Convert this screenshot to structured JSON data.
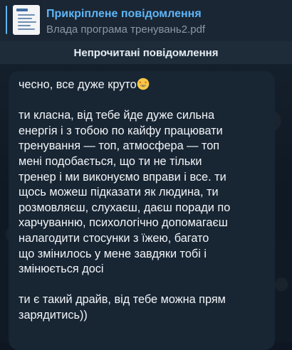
{
  "pinned": {
    "title": "Прикріплене повідомлення",
    "subtitle": "Влада програма тренувань2.pdf",
    "thumbnail_icon": "pdf-document-icon"
  },
  "unread_divider": {
    "label": "Непрочитані повідомлення"
  },
  "message": {
    "line_1": "чесно, все дуже круто",
    "emoji_1": "star-struck-emoji-icon",
    "paragraph_2": [
      "ти класна, від тебе йде дуже сильна",
      "енергія і з тобою по кайфу працювати",
      "тренування — топ, атмосфера — топ",
      "мені подобається, що ти не тільки",
      "тренер і ми виконуємо вправи і все. ти",
      "щось можеш підказати як людина, ти",
      "розмовляєш, слухаєш, даєш поради по",
      "харчуванню, психологічно допомагаєш",
      "налагодити стосунки з їжею, багато",
      "що змінилось у мене завдяки тобі і",
      "змінюється досі"
    ],
    "paragraph_3": [
      "ти є такий драйв, від тебе можна прям",
      "зарядитись))"
    ]
  },
  "colors": {
    "accent": "#5eb5f7",
    "background": "#0e1621",
    "bubble": "#182533",
    "text": "#f2f5f8"
  }
}
